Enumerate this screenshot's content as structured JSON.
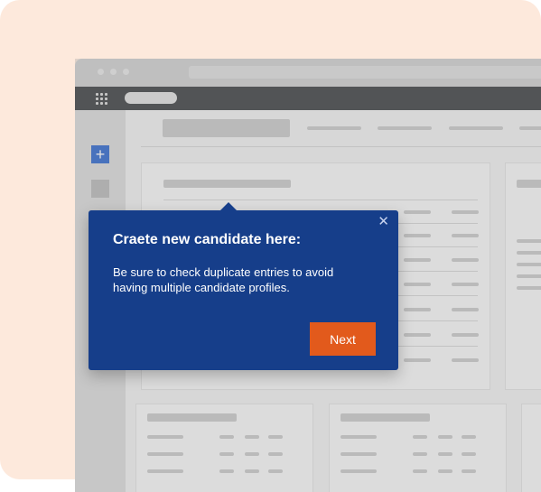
{
  "popover": {
    "title": "Craete new candidate here:",
    "body": "Be sure to check duplicate entries to avoid having multiple candidate profiles.",
    "next_label": "Next",
    "close_icon": "close-icon"
  },
  "sidebar": {
    "add_icon": "plus-icon",
    "add_symbol": "+"
  },
  "colors": {
    "popover_bg": "#163e8a",
    "next_button": "#e25a1c",
    "background": "#fde9dc",
    "app_bar": "#2e3134"
  }
}
